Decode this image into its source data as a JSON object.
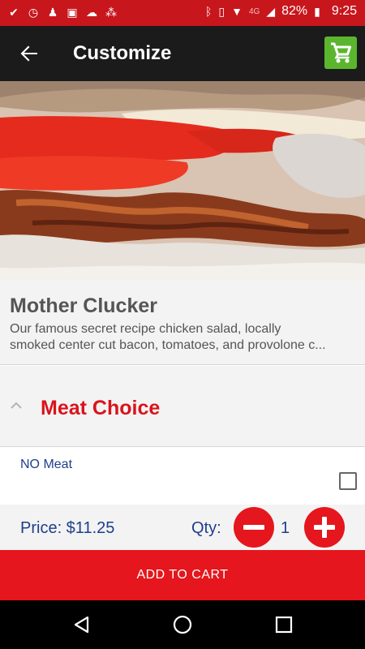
{
  "status_bar": {
    "network": "4G",
    "battery": "82%",
    "time": "9:25"
  },
  "app_bar": {
    "title": "Customize"
  },
  "product": {
    "name": "Mother Clucker",
    "description_line1": "Our famous secret recipe chicken salad, locally",
    "description_line2": "smoked center cut bacon, tomatoes, and provolone c..."
  },
  "section": {
    "title": "Meat Choice",
    "expanded": true
  },
  "options": [
    {
      "label": "NO Meat",
      "checked": false
    }
  ],
  "order": {
    "price_label": "Price: $11.25",
    "qty_label": "Qty:",
    "qty_value": "1",
    "add_to_cart_label": "ADD TO CART"
  },
  "colors": {
    "status_bar": "#c8161d",
    "app_bar": "#1b1b1b",
    "accent_red": "#e5161d",
    "cart_green": "#5cb52e",
    "label_blue": "#1e3f8a"
  }
}
